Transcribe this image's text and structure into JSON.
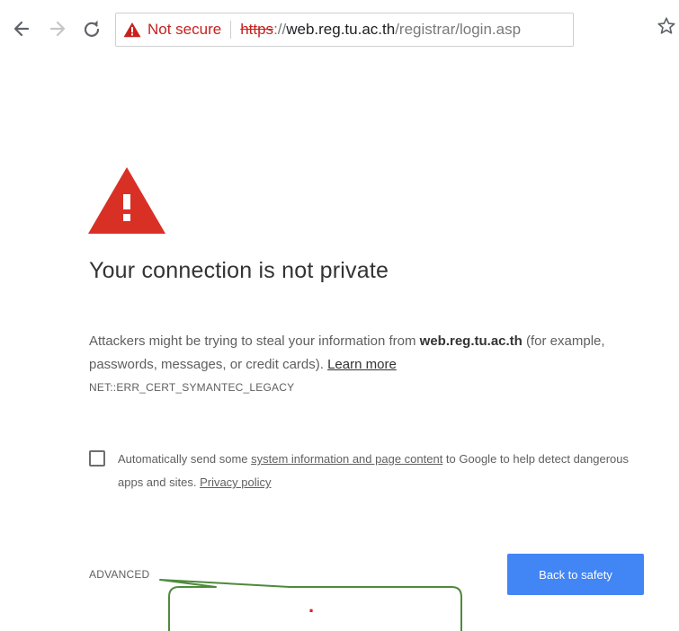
{
  "browser": {
    "security_label": "Not secure",
    "url": {
      "scheme": "https",
      "separator": "://",
      "host": "web.reg.tu.ac.th",
      "path": "/registrar/login.asp"
    },
    "icons": {
      "back": "back-arrow-icon",
      "forward": "forward-arrow-icon",
      "reload": "reload-icon",
      "warning": "warning-triangle-icon",
      "bookmark": "star-icon"
    }
  },
  "interstitial": {
    "headline": "Your connection is not private",
    "description_prefix": "Attackers might be trying to steal your information from ",
    "description_host": "web.reg.tu.ac.th",
    "description_suffix": " (for example, passwords, messages, or credit cards). ",
    "learn_more": "Learn more",
    "error_code": "NET::ERR_CERT_SYMANTEC_LEGACY",
    "optin": {
      "checked": false,
      "prefix": "Automatically send some ",
      "link": "system information and page content",
      "middle": " to Google to help detect dangerous apps and sites. ",
      "privacy_link": "Privacy policy"
    },
    "advanced_label": "ADVANCED",
    "back_to_safety_label": "Back to safety"
  },
  "annotation": {
    "mark": "."
  },
  "colors": {
    "danger_red": "#d93025",
    "security_red": "#c5221f",
    "button_blue": "#4285f4",
    "callout_green": "#4f8a3c",
    "callout_mark_red": "#e02020"
  }
}
